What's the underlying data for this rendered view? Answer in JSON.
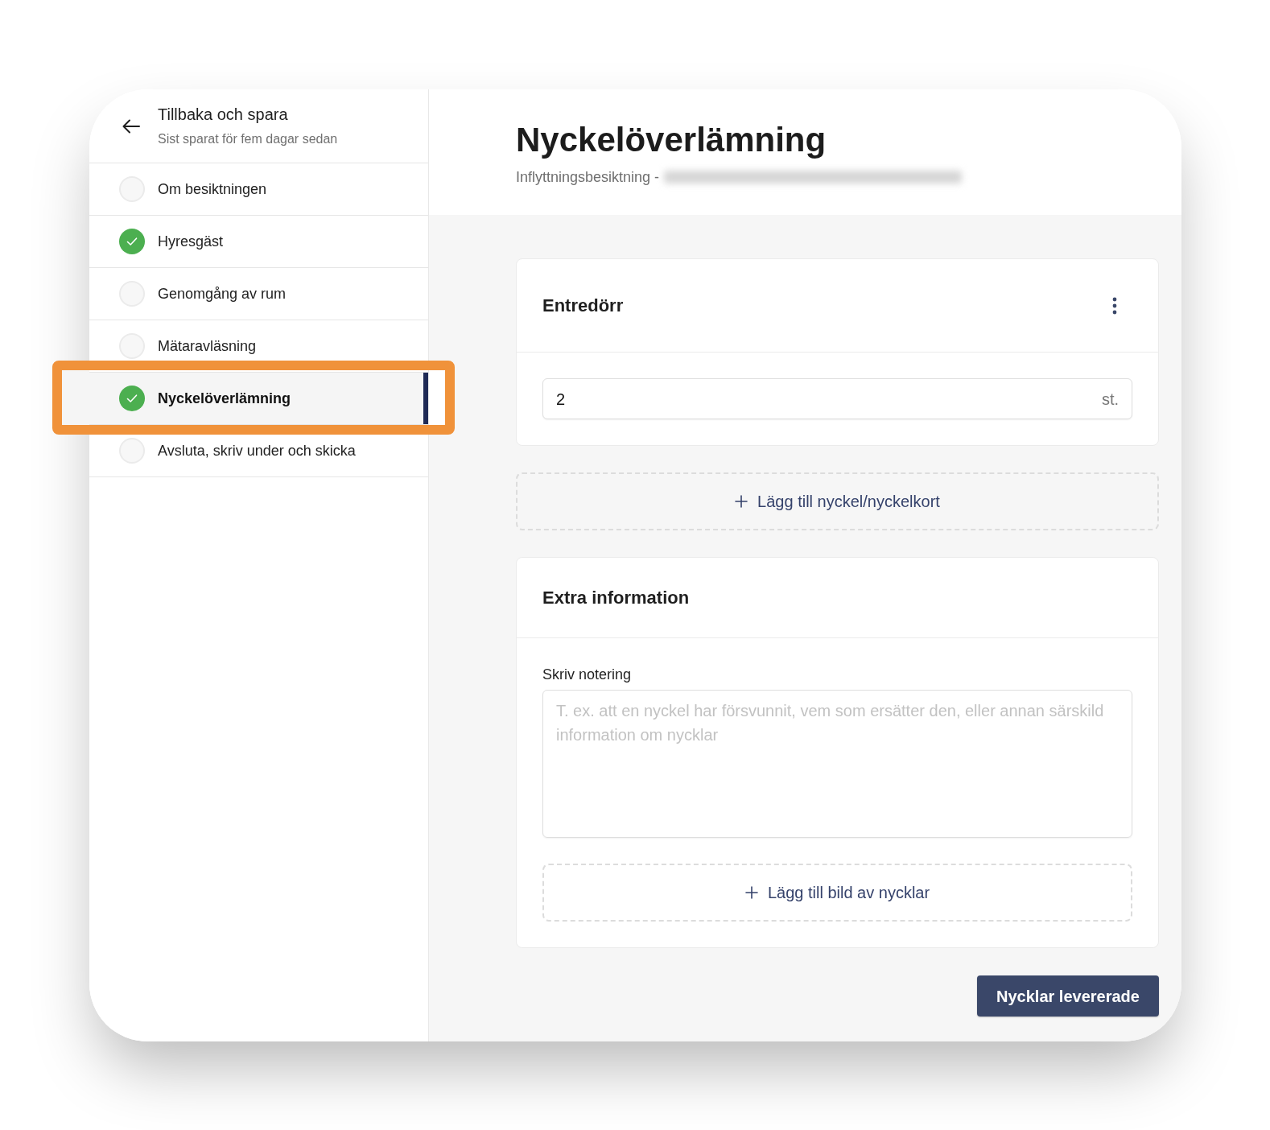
{
  "sidebar": {
    "back_title": "Tillbaka och spara",
    "save_status": "Sist sparat för fem dagar sedan"
  },
  "steps": [
    {
      "label": "Om besiktningen",
      "done": false,
      "selected": false,
      "highlighted": false
    },
    {
      "label": "Hyresgäst",
      "done": true,
      "selected": false,
      "highlighted": false
    },
    {
      "label": "Genomgång av rum",
      "done": false,
      "selected": false,
      "highlighted": false
    },
    {
      "label": "Mätaravläsning",
      "done": false,
      "selected": false,
      "highlighted": false
    },
    {
      "label": "Nyckelöverlämning",
      "done": true,
      "selected": true,
      "highlighted": true
    },
    {
      "label": "Avsluta, skriv under och skicka",
      "done": false,
      "selected": false,
      "highlighted": false
    }
  ],
  "header": {
    "title": "Nyckelöverlämning",
    "subtitle": "Inflyttningsbesiktning -",
    "subtitle_blurred": true
  },
  "key_cards": [
    {
      "title": "Entredörr",
      "count": "2",
      "unit": "st."
    }
  ],
  "add_key_button": "Lägg till nyckel/nyckelkort",
  "extra_info": {
    "title": "Extra information",
    "note": {
      "label": "Skriv notering",
      "placeholder": "T. ex. att en nyckel har försvunnit, vem som ersätter den, eller annan särskild information om nycklar"
    },
    "add_photo_button": "Lägg till bild av nycklar"
  },
  "submit_button": "Nycklar levererade"
}
